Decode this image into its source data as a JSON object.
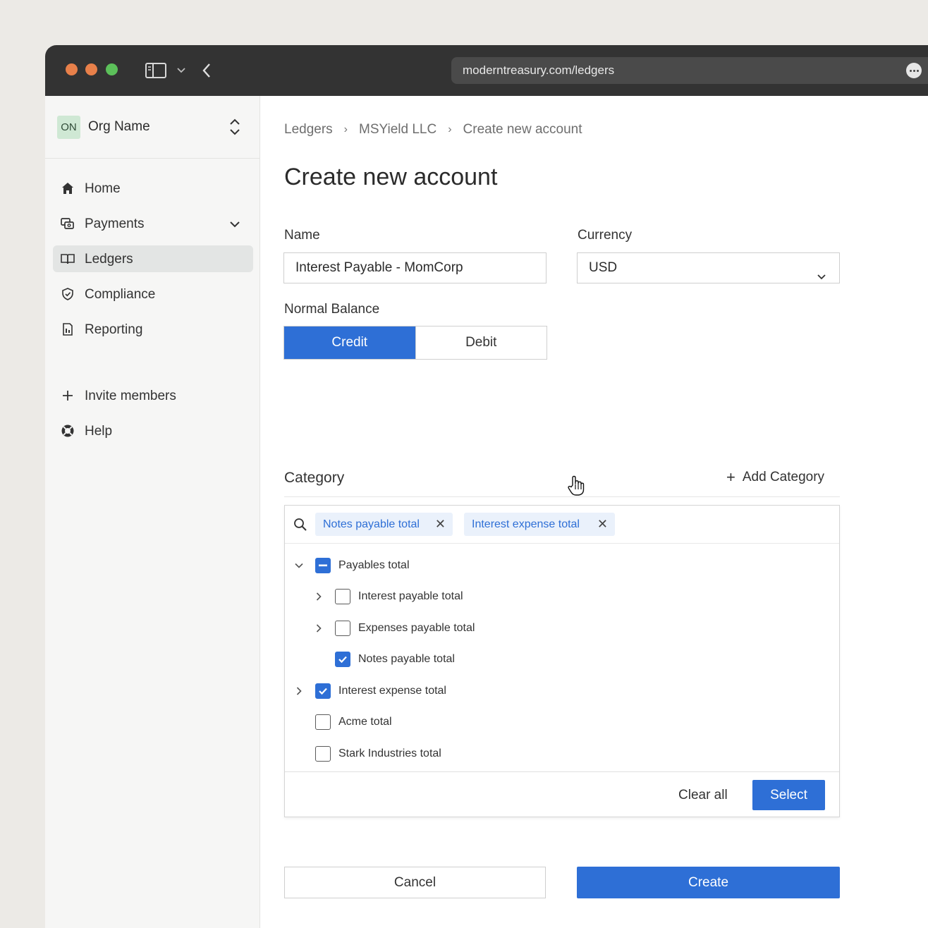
{
  "browser": {
    "url": "moderntreasury.com/ledgers",
    "traffic_colors": [
      "#e8804a",
      "#e8804a",
      "#5cc05a"
    ]
  },
  "sidebar": {
    "org_initials": "ON",
    "org_name": "Org Name",
    "items": [
      {
        "label": "Home",
        "icon": "home-icon"
      },
      {
        "label": "Payments",
        "icon": "payments-icon"
      },
      {
        "label": "Ledgers",
        "icon": "book-icon",
        "active": true
      },
      {
        "label": "Compliance",
        "icon": "shield-icon"
      },
      {
        "label": "Reporting",
        "icon": "report-icon"
      }
    ],
    "secondary": [
      {
        "label": "Invite members",
        "icon": "plus-icon"
      },
      {
        "label": "Help",
        "icon": "lifebuoy-icon"
      }
    ]
  },
  "breadcrumb": [
    "Ledgers",
    "MSYield LLC",
    "Create new account"
  ],
  "page_title": "Create new account",
  "form": {
    "name_label": "Name",
    "name_value": "Interest Payable - MomCorp",
    "currency_label": "Currency",
    "currency_value": "USD",
    "normal_balance_label": "Normal Balance",
    "credit_label": "Credit",
    "debit_label": "Debit",
    "selected_balance": "Credit"
  },
  "category": {
    "title": "Category",
    "add_label": "Add Category",
    "chips": [
      "Notes payable total",
      "Interest expense total"
    ],
    "tree": [
      {
        "label": "Payables total",
        "state": "mixed",
        "expanded": true,
        "level": 0
      },
      {
        "label": "Interest payable total",
        "state": "unchecked",
        "expandable": true,
        "level": 1
      },
      {
        "label": "Expenses payable total",
        "state": "unchecked",
        "expandable": true,
        "level": 1
      },
      {
        "label": "Notes payable total",
        "state": "checked",
        "level": 1
      },
      {
        "label": "Interest expense total",
        "state": "checked",
        "expandable": true,
        "level": 0
      },
      {
        "label": "Acme total",
        "state": "unchecked",
        "level": 0
      },
      {
        "label": "Stark Industries total",
        "state": "unchecked",
        "level": 0
      }
    ],
    "clear_all_label": "Clear all",
    "select_label": "Select"
  },
  "actions": {
    "cancel_label": "Cancel",
    "create_label": "Create"
  },
  "colors": {
    "accent": "#2e6fd6",
    "chip_bg": "#eaf1fb",
    "org_badge": "#cfe8d4"
  }
}
